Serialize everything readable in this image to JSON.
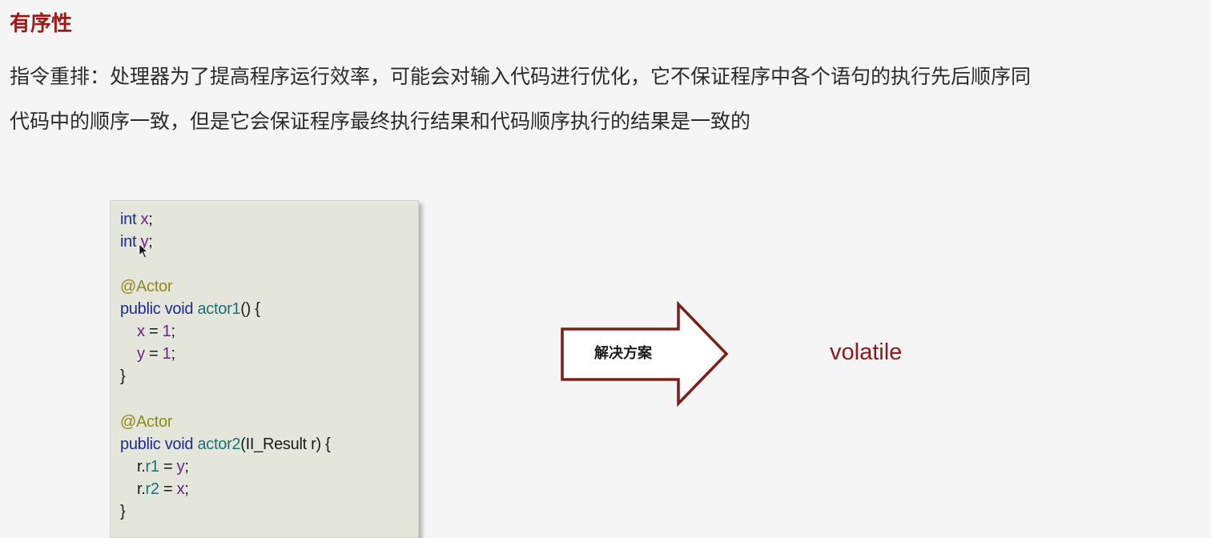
{
  "heading": "有序性",
  "paragraph": {
    "line1": "指令重排：处理器为了提高程序运行效率，可能会对输入代码进行优化，它不保证程序中各个语句的执行先后顺序同",
    "line2": "代码中的顺序一致，但是它会保证程序最终执行结果和代码顺序执行的结果是一致的"
  },
  "code": {
    "line1": {
      "kw": "int",
      "var": "x",
      "rest": ";"
    },
    "line2": {
      "kw": "int",
      "var": "y",
      "rest": ";"
    },
    "annotation1": "@Actor",
    "method1": {
      "kw": "public void",
      "name": "actor1",
      "rest": "() {"
    },
    "assign1": {
      "var": "x",
      "op": " = ",
      "num": "1",
      "rest": ";"
    },
    "assign2": {
      "var": "y",
      "op": " = ",
      "num": "1",
      "rest": ";"
    },
    "close1": "}",
    "annotation2": "@Actor",
    "method2": {
      "kw": "public void",
      "name": "actor2",
      "rest": "(II_Result r) {"
    },
    "assign3": {
      "prefix": "r.",
      "field": "r1",
      "op": " = ",
      "var": "y",
      "rest": ";"
    },
    "assign4": {
      "prefix": "r.",
      "field": "r2",
      "op": " = ",
      "var": "x",
      "rest": ";"
    },
    "close2": "}"
  },
  "arrow_label": "解决方案",
  "solution": "volatile",
  "colors": {
    "heading": "#9b1b1b",
    "solution": "#8b1a1a",
    "arrow_stroke": "#7a1f1a"
  }
}
